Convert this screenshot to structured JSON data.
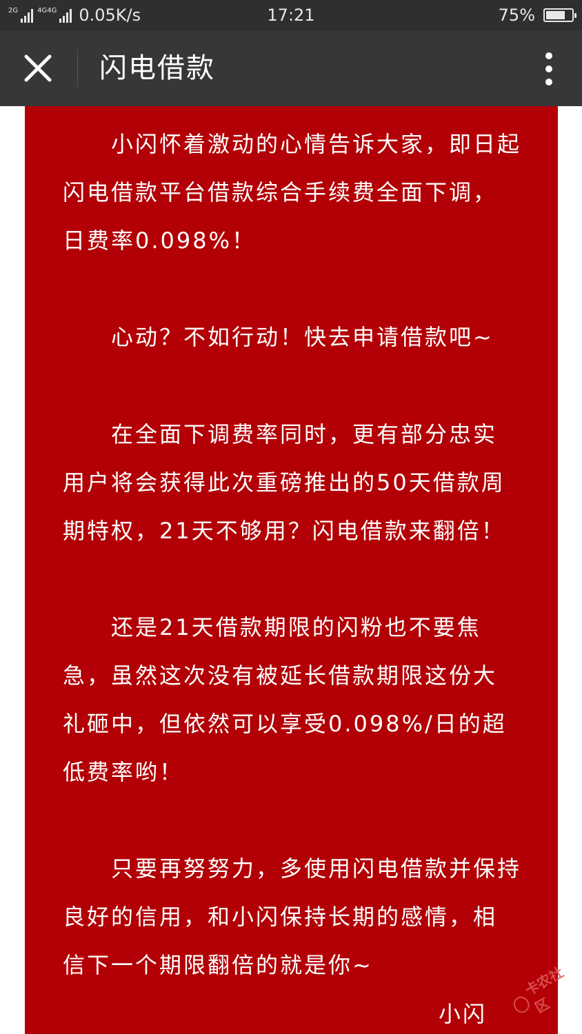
{
  "status_bar": {
    "signal1_label": "2G",
    "signal2_label": "4G4G",
    "net_speed": "0.05K/s",
    "time": "17:21",
    "battery_text": "75%",
    "battery_level": 0.75
  },
  "nav": {
    "close_icon": "close-icon",
    "title": "闪电借款",
    "more_icon": "more-vertical-icon"
  },
  "article": {
    "paragraphs": [
      {
        "lines": [
          "　　小闪怀着激动的心情告诉大家，即日起",
          "闪电借款平台借款综合手续费全面下调，",
          "日费率0.098%！"
        ]
      },
      {
        "lines": [
          "　　心动？不如行动！快去申请借款吧~"
        ]
      },
      {
        "lines": [
          "　　在全面下调费率同时，更有部分忠实",
          "用户将会获得此次重磅推出的50天借款周",
          "期特权，21天不够用？闪电借款来翻倍！"
        ]
      },
      {
        "lines": [
          "　　还是21天借款期限的闪粉也不要焦",
          "急，虽然这次没有被延长借款期限这份大",
          "礼砸中，但依然可以享受0.098%/日的超",
          "低费率哟！"
        ]
      },
      {
        "lines": [
          "　　只要再努努力，多使用闪电借款并保持",
          "良好的信用，和小闪保持长期的感情，相",
          "信下一个期限翻倍的就是你~"
        ]
      }
    ],
    "signature": "小闪"
  },
  "watermark": {
    "text": "卡农社区"
  },
  "colors": {
    "status_bg": "#2f2f2f",
    "nav_bg": "#373737",
    "content_bg": "#b20006",
    "text": "#ffffff"
  }
}
